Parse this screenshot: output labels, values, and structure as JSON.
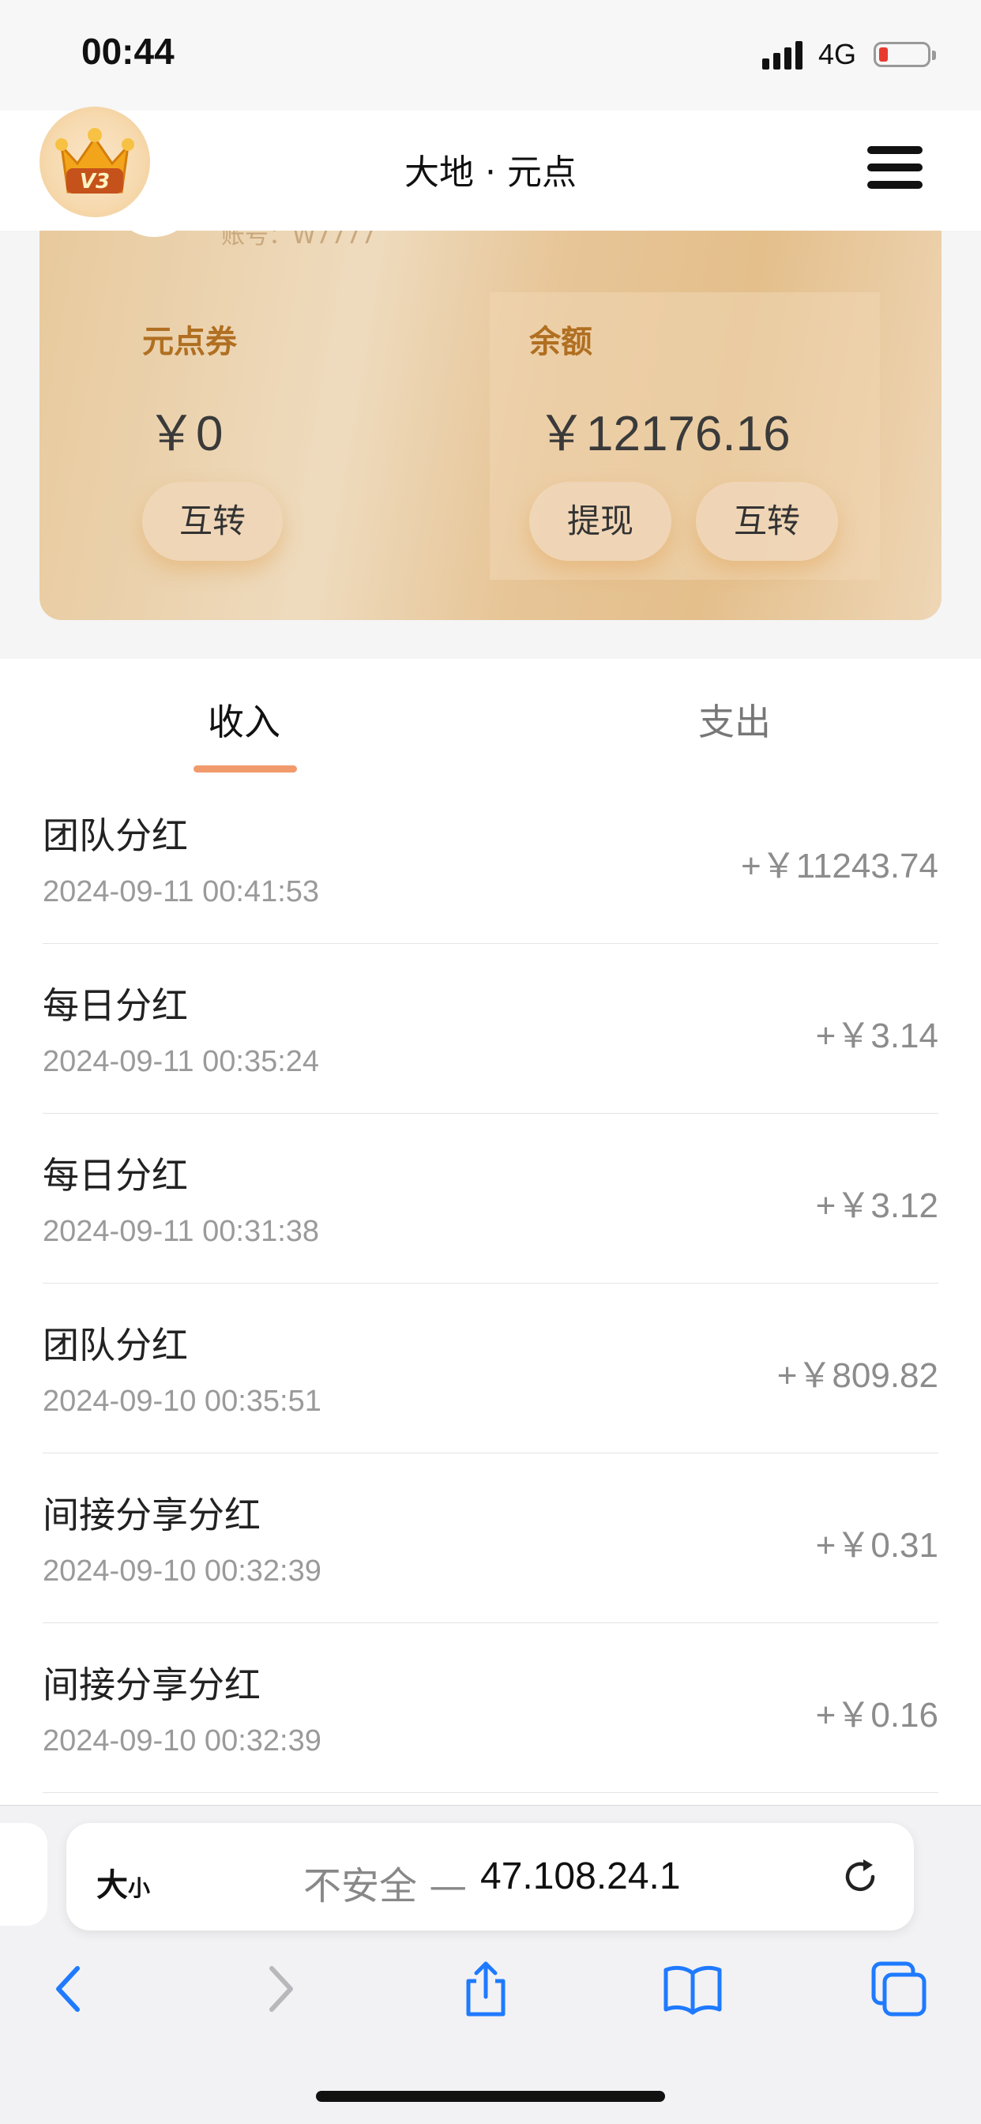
{
  "status": {
    "time": "00:44",
    "network": "4G"
  },
  "header": {
    "title": "大地 · 元点",
    "badge_text": "V3"
  },
  "wallet": {
    "account_partial": "账号：W7777",
    "coupon": {
      "label": "元点券",
      "value": "￥0",
      "transfer_label": "互转"
    },
    "balance": {
      "label": "余额",
      "value": "￥12176.16",
      "withdraw_label": "提现",
      "transfer_label": "互转"
    }
  },
  "tabs": [
    {
      "label": "收入",
      "active": true
    },
    {
      "label": "支出",
      "active": false
    }
  ],
  "records": [
    {
      "title": "团队分红",
      "time": "2024-09-11 00:41:53",
      "amount": "+￥11243.74"
    },
    {
      "title": "每日分红",
      "time": "2024-09-11 00:35:24",
      "amount": "+￥3.14"
    },
    {
      "title": "每日分红",
      "time": "2024-09-11 00:31:38",
      "amount": "+￥3.12"
    },
    {
      "title": "团队分红",
      "time": "2024-09-10 00:35:51",
      "amount": "+￥809.82"
    },
    {
      "title": "间接分享分红",
      "time": "2024-09-10 00:32:39",
      "amount": "+￥0.31"
    },
    {
      "title": "间接分享分红",
      "time": "2024-09-10 00:32:39",
      "amount": "+￥0.16"
    }
  ],
  "browser": {
    "text_size_label": "大",
    "text_size_small": "小",
    "insecure_label": "不安全 —",
    "host": "47.108.24.1"
  },
  "colors": {
    "accent": "#f19a6c",
    "label_brown": "#b06f21",
    "card_tan": "#e8c99c"
  }
}
